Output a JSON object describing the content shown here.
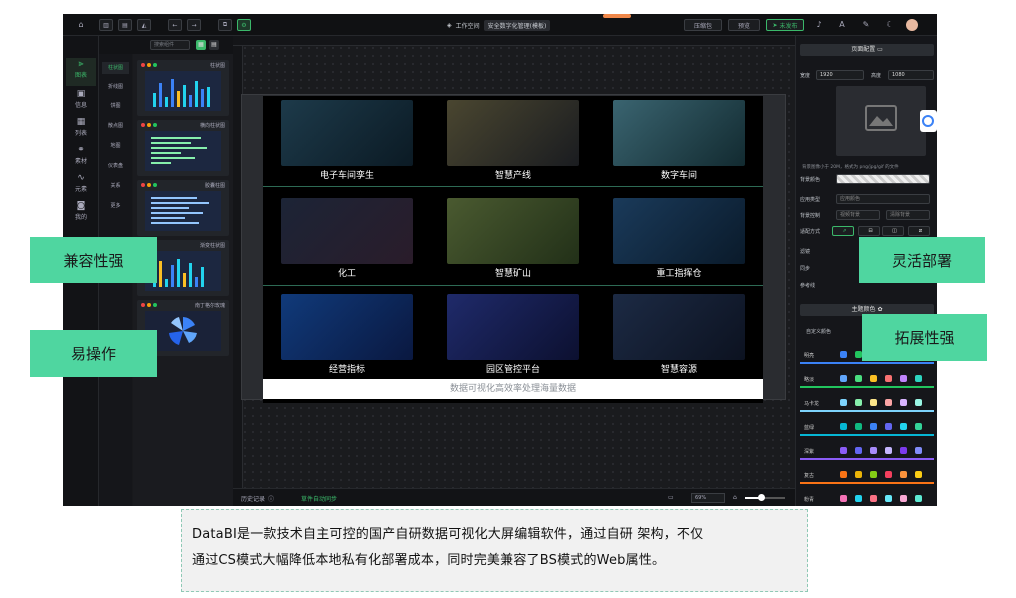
{
  "topbar": {
    "breadcrumb_workspace": "工作空间",
    "breadcrumb_project": "安全数字化管理(模板)",
    "btn_zip": "压缩包",
    "btn_preview": "预览",
    "btn_publish": "未发布"
  },
  "sidebar": {
    "panel_title": "组件",
    "search_placeholder": "搜索组件",
    "categories": [
      {
        "label": "图表",
        "icon": "chart-icon"
      },
      {
        "label": "信息",
        "icon": "info-icon"
      },
      {
        "label": "列表",
        "icon": "list-icon"
      },
      {
        "label": "素材",
        "icon": "material-icon"
      },
      {
        "label": "元素",
        "icon": "element-icon"
      },
      {
        "label": "我的",
        "icon": "my-icon"
      }
    ],
    "subcategories": [
      "柱状图",
      "折线图",
      "饼图",
      "散点图",
      "地图",
      "仪表盘",
      "关系",
      "更多"
    ],
    "thumbnails": [
      "柱状图",
      "横向柱状图",
      "胶囊柱图",
      "渐变柱状图",
      "南丁格尔玫瑰"
    ]
  },
  "canvas": {
    "cells": [
      {
        "label": "电子车间孪生",
        "bg": "#1d3a4a"
      },
      {
        "label": "智慧产线",
        "bg": "#3a3a2a"
      },
      {
        "label": "数字车间",
        "bg": "#2c4a52"
      },
      {
        "label": "化工",
        "bg": "#1c2436"
      },
      {
        "label": "智慧矿山",
        "bg": "#3b4a2a"
      },
      {
        "label": "重工指挥仓",
        "bg": "#14304a"
      },
      {
        "label": "经营指标",
        "bg": "#0f2a5a"
      },
      {
        "label": "园区管控平台",
        "bg": "#1a1f4a"
      },
      {
        "label": "智慧容源",
        "bg": "#1c2434"
      }
    ],
    "caption": "数据可视化高效率处理海量数据"
  },
  "bottombar": {
    "history": "历史记录",
    "sync": "草件自动同步",
    "zoom": "69%"
  },
  "rightpanel": {
    "tab_page_config": "页面配置",
    "width_label": "宽度",
    "width_value": "1920",
    "height_label": "高度",
    "height_value": "1080",
    "bg_hint": "背景图像小于 20M，格式为 png/jpg/gif 的文件",
    "bg_color_label": "背景颜色",
    "apply_type_label": "应用类型",
    "apply_type_value": "应用颜色",
    "bg_control_label": "背景控制",
    "bg_control_a": "视频背景",
    "bg_control_b": "清除背景",
    "fit_label": "适配方式",
    "filter_label": "滤镜",
    "sync_label": "同步",
    "ref_label": "参考线",
    "theme_tab": "主题颜色",
    "custom_color": "自定义颜色",
    "palettes": [
      {
        "name": "明亮",
        "colors": [
          "#3b82f6",
          "#22c55e",
          "#f59e0b",
          "#ef4444",
          "#a855f7",
          "#14b8a6"
        ],
        "ul": "#3b82f6"
      },
      {
        "name": "略淡",
        "colors": [
          "#60a5fa",
          "#4ade80",
          "#fbbf24",
          "#f87171",
          "#c084fc",
          "#2dd4bf"
        ],
        "ul": "#22c55e"
      },
      {
        "name": "马卡龙",
        "colors": [
          "#7dd3fc",
          "#86efac",
          "#fde68a",
          "#fca5a5",
          "#d8b4fe",
          "#99f6e4"
        ],
        "ul": "#7dd3fc"
      },
      {
        "name": "蓝绿",
        "colors": [
          "#06b6d4",
          "#10b981",
          "#3b82f6",
          "#6366f1",
          "#22d3ee",
          "#34d399"
        ],
        "ul": "#06b6d4"
      },
      {
        "name": "深紫",
        "colors": [
          "#8b5cf6",
          "#6366f1",
          "#a78bfa",
          "#c4b5fd",
          "#7c3aed",
          "#818cf8"
        ],
        "ul": "#8b5cf6"
      },
      {
        "name": "复古",
        "colors": [
          "#f97316",
          "#eab308",
          "#84cc16",
          "#f43f5e",
          "#fb923c",
          "#facc15"
        ],
        "ul": "#f97316"
      },
      {
        "name": "粉青",
        "colors": [
          "#f472b6",
          "#22d3ee",
          "#fb7185",
          "#67e8f9",
          "#f9a8d4",
          "#5eead4"
        ],
        "ul": "#f472b6"
      }
    ]
  },
  "callouts": {
    "compat": "兼容性强",
    "easy": "易操作",
    "flexible": "灵活部署",
    "extend": "拓展性强"
  },
  "note": {
    "line1": "DataBI是一款技术自主可控的国产自研数据可视化大屏编辑软件，通过自研 架构，不仅",
    "line2": "通过CS模式大幅降低本地私有化部署成本，同时完美兼容了BS模式的Web属性。"
  },
  "colors": {
    "accent": "#3bb86a",
    "callout": "#4fd6a0"
  }
}
